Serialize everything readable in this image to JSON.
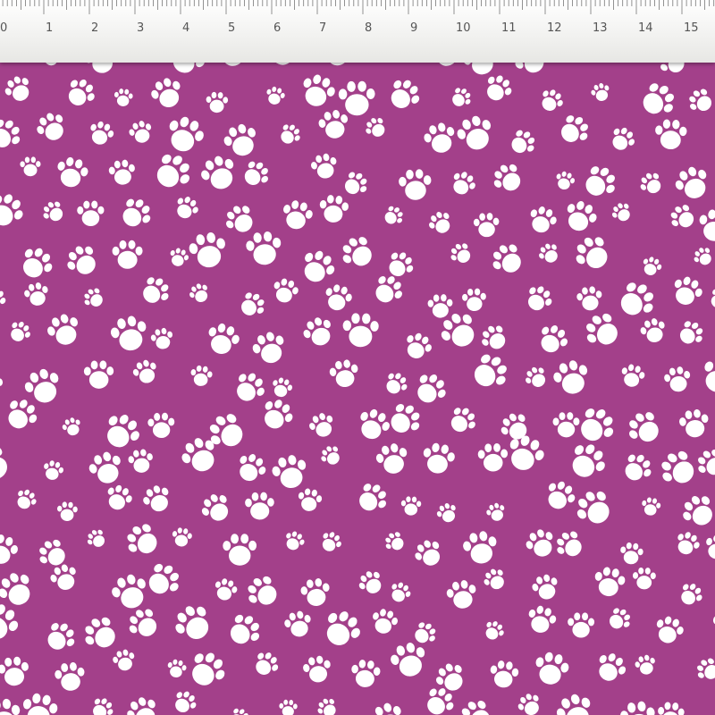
{
  "ruler": {
    "units": [
      0,
      1,
      2,
      3,
      4,
      5,
      6,
      7,
      8,
      9,
      10,
      11,
      12,
      13,
      14,
      15
    ],
    "tick_color": "#777777",
    "label_color": "#555555"
  },
  "fabric": {
    "background_color": "#a3408a",
    "motif": "paw-print",
    "motif_color": "#ffffff"
  }
}
